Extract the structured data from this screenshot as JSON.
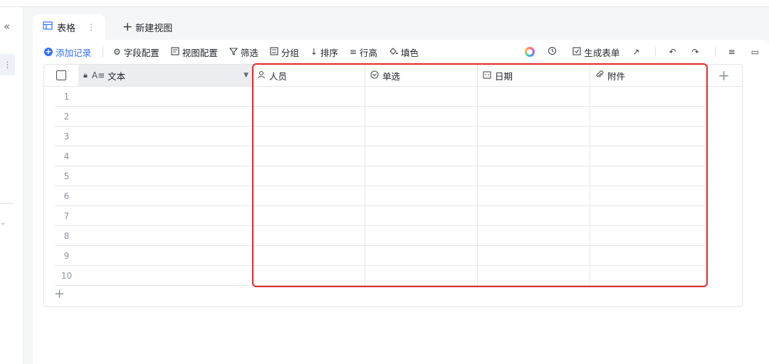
{
  "sidebar": {
    "collapse_icon": "«",
    "more_icon": "⋮",
    "handle_icon": "⌄"
  },
  "tabs": [
    {
      "label": "表格",
      "icon": "table-icon",
      "active": true
    },
    {
      "label": "新建视图",
      "icon": "plus-icon",
      "active": false
    }
  ],
  "toolbar": {
    "add_record": "添加记录",
    "field_config": "字段配置",
    "view_config": "视图配置",
    "filter": "筛选",
    "group": "分组",
    "sort": "排序",
    "row_height": "行高",
    "fill_color": "填色",
    "generate_form": "生成表单"
  },
  "table": {
    "columns": [
      {
        "label": "文本",
        "icon": "text-field-icon",
        "locked": true
      },
      {
        "label": "人员",
        "icon": "person-icon"
      },
      {
        "label": "单选",
        "icon": "single-select-icon"
      },
      {
        "label": "日期",
        "icon": "calendar-icon"
      },
      {
        "label": "附件",
        "icon": "attachment-icon"
      }
    ],
    "rows": [
      "1",
      "2",
      "3",
      "4",
      "5",
      "6",
      "7",
      "8",
      "9",
      "10"
    ]
  },
  "colors": {
    "accent": "#3370ff",
    "highlight": "#e02a2a",
    "header_bg": "#ebedf0"
  }
}
